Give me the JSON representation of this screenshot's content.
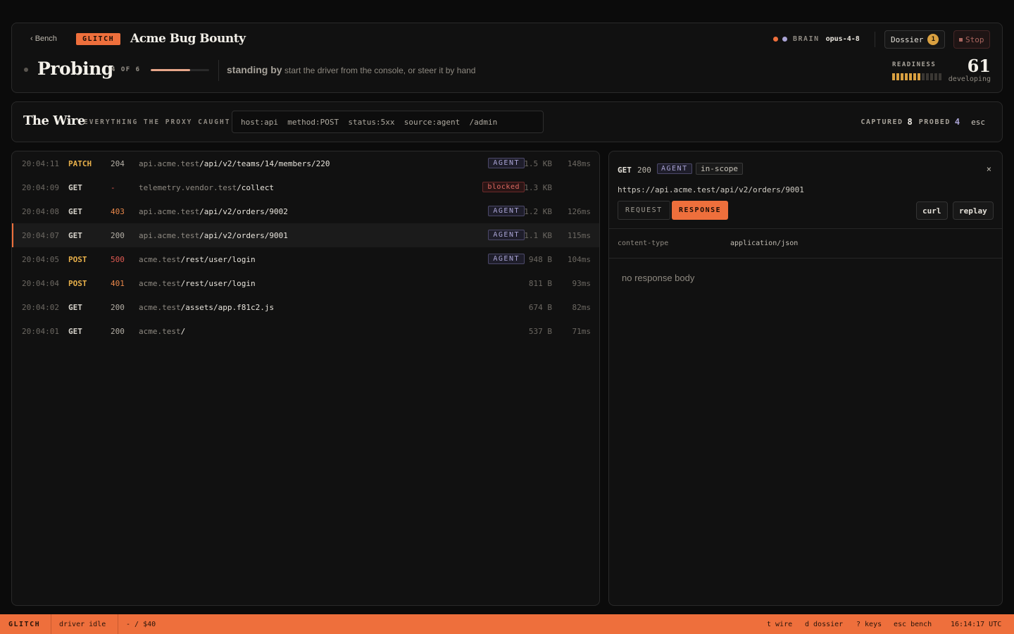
{
  "header": {
    "back_label": "‹ Bench",
    "brand_tag": "GLITCH",
    "program_title": "Acme Bug Bounty",
    "brain_label": "BRAIN",
    "brain_model": "opus-4-8",
    "dossier_label": "Dossier",
    "dossier_count": "1",
    "stop_label": "Stop",
    "phase": "Probing",
    "step": "4 OF 6",
    "step_progress_pct": 67,
    "state": "standing by",
    "state_desc": "start the driver from the console, or steer it by hand",
    "readiness_label": "READINESS",
    "readiness_score": "61",
    "readiness_level": "developing",
    "readiness_segments_filled": 7,
    "readiness_segments_total": 12
  },
  "wire": {
    "title": "The Wire",
    "subtitle": "EVERYTHING THE PROXY CAUGHT",
    "filter_value": "host:api  method:POST  status:5xx  source:agent  /admin",
    "captured_label": "CAPTURED",
    "captured_count": "8",
    "probed_label": "PROBED",
    "probed_count": "4",
    "esc_label": "esc"
  },
  "requests": [
    {
      "time": "20:04:11",
      "method": "PATCH",
      "status": "204",
      "host": "api.acme.test",
      "path": "/api/v2/teams/14/members/220",
      "tag": "AGENT",
      "size": "1.5 KB",
      "duration": "148ms"
    },
    {
      "time": "20:04:09",
      "method": "GET",
      "status": "-",
      "host": "telemetry.vendor.test",
      "path": "/collect",
      "tag": "blocked",
      "size": "1.3 KB",
      "duration": ""
    },
    {
      "time": "20:04:08",
      "method": "GET",
      "status": "403",
      "host": "api.acme.test",
      "path": "/api/v2/orders/9002",
      "tag": "AGENT",
      "size": "1.2 KB",
      "duration": "126ms"
    },
    {
      "time": "20:04:07",
      "method": "GET",
      "status": "200",
      "host": "api.acme.test",
      "path": "/api/v2/orders/9001",
      "tag": "AGENT",
      "size": "1.1 KB",
      "duration": "115ms",
      "selected": true
    },
    {
      "time": "20:04:05",
      "method": "POST",
      "status": "500",
      "host": "acme.test",
      "path": "/rest/user/login",
      "tag": "AGENT",
      "size": "948 B",
      "duration": "104ms"
    },
    {
      "time": "20:04:04",
      "method": "POST",
      "status": "401",
      "host": "acme.test",
      "path": "/rest/user/login",
      "tag": "",
      "size": "811 B",
      "duration": "93ms"
    },
    {
      "time": "20:04:02",
      "method": "GET",
      "status": "200",
      "host": "acme.test",
      "path": "/assets/app.f81c2.js",
      "tag": "",
      "size": "674 B",
      "duration": "82ms"
    },
    {
      "time": "20:04:01",
      "method": "GET",
      "status": "200",
      "host": "acme.test",
      "path": "/",
      "tag": "",
      "size": "537 B",
      "duration": "71ms"
    }
  ],
  "detail": {
    "method": "GET",
    "status": "200",
    "source_tag": "AGENT",
    "scope_tag": "in-scope",
    "close_glyph": "×",
    "url": "https://api.acme.test/api/v2/orders/9001",
    "tab_request": "REQUEST",
    "tab_response": "RESPONSE",
    "curl_label": "curl",
    "replay_label": "replay",
    "header_key": "content-type",
    "header_value": "application/json",
    "empty_body": "no response body"
  },
  "statusbar": {
    "brand": "GLITCH",
    "driver": "driver idle",
    "budget": "- / $40",
    "key_wire": "t wire",
    "key_dossier": "d dossier",
    "key_keys": "? keys",
    "key_bench": "esc bench",
    "clock": "16:14:17 UTC"
  },
  "colors": {
    "accent": "#ee6f3c",
    "method_write": "#e8b04a",
    "status_warn": "#e8874a",
    "status_error": "#e05a52",
    "agent_purple": "#a9a3d4"
  }
}
